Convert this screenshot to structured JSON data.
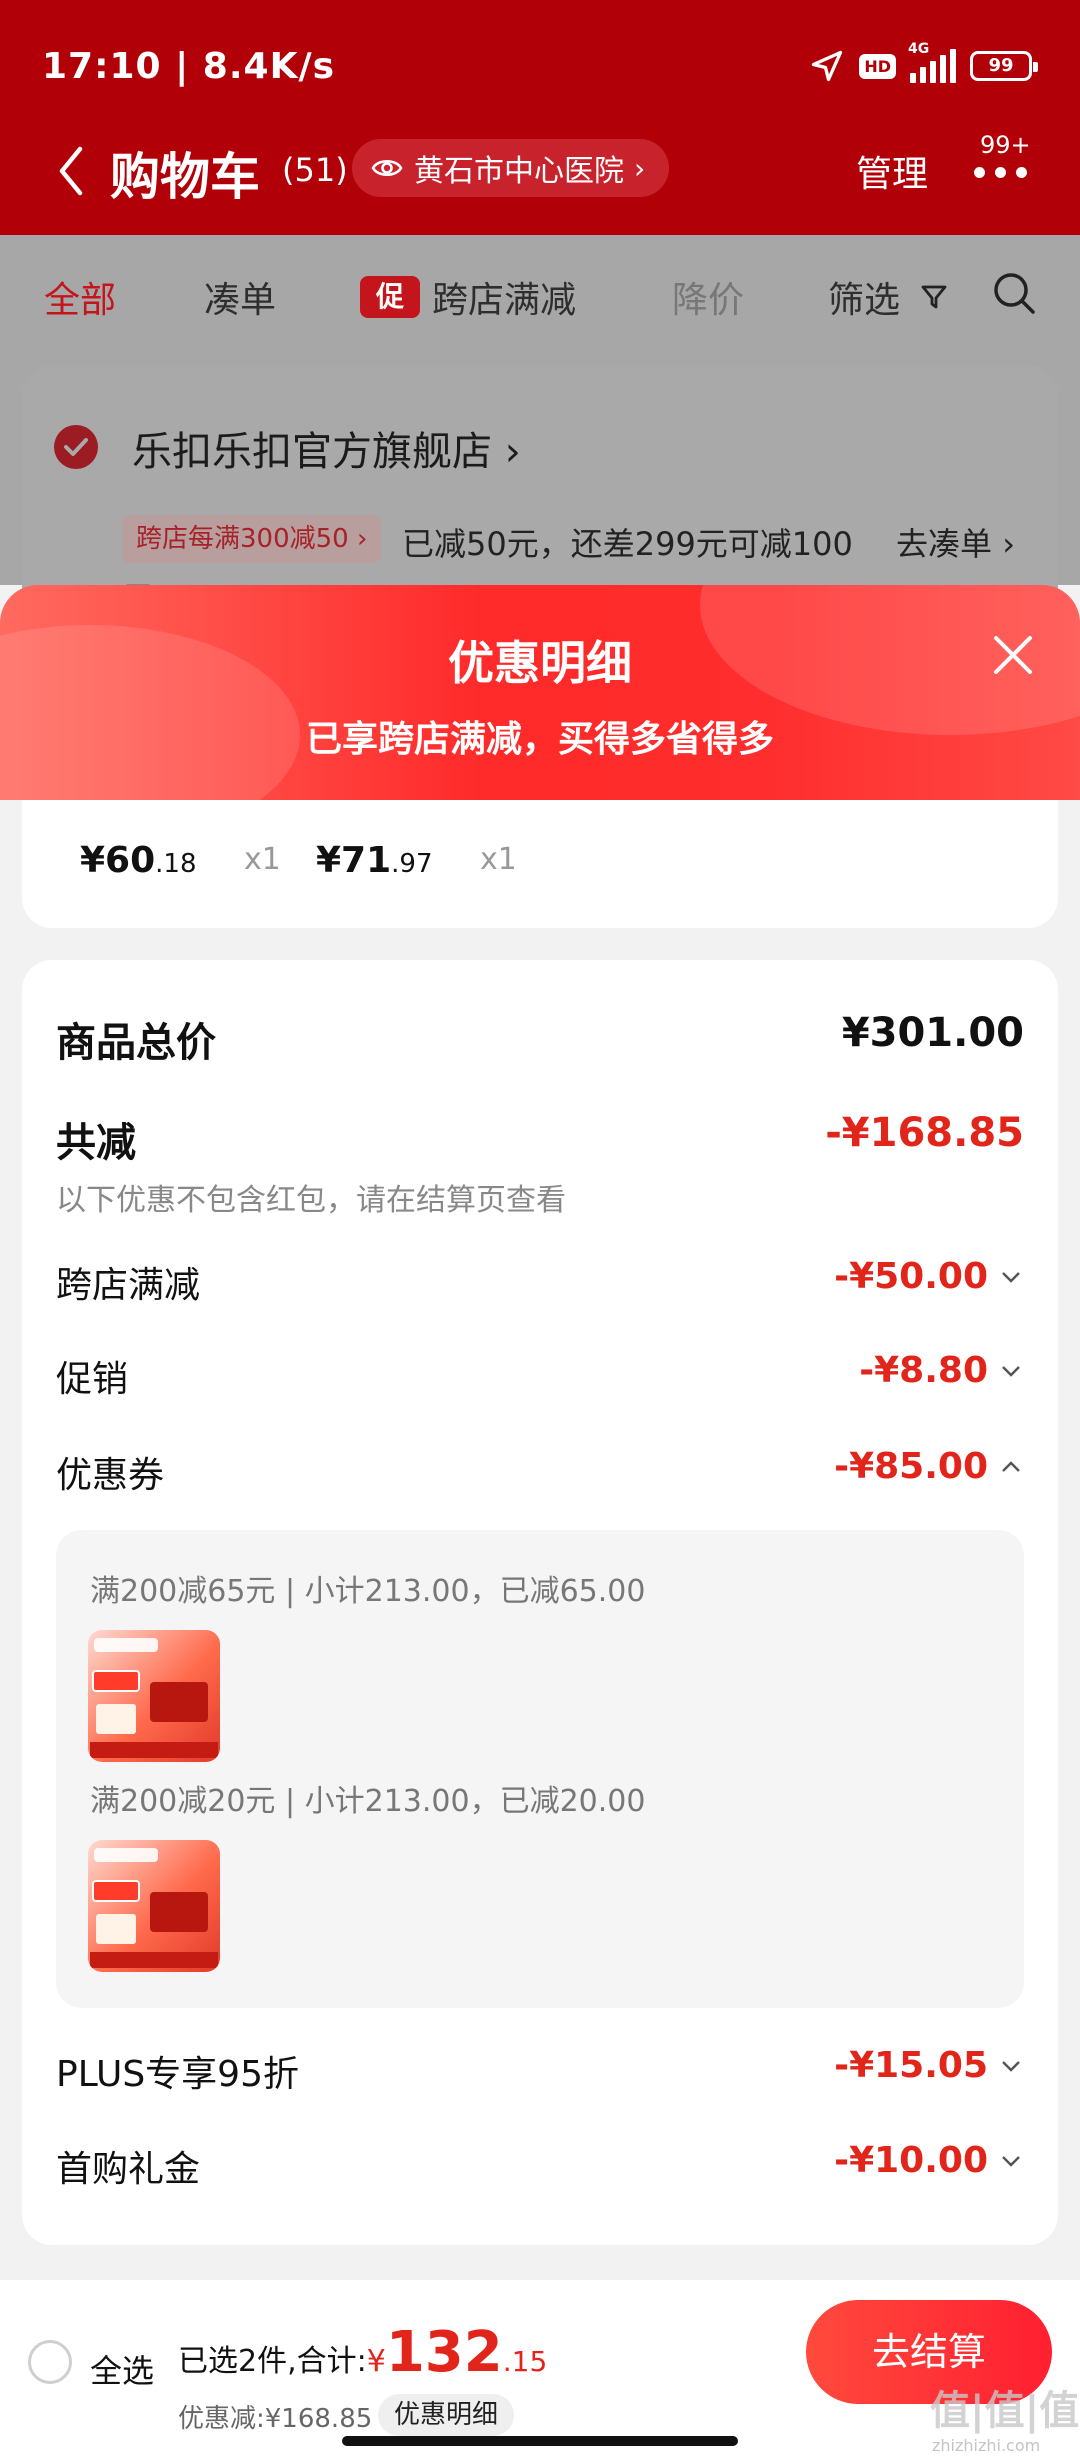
{
  "status_bar": {
    "time_speed": "17:10 | 8.4K/s",
    "hd": "HD",
    "network": "4G",
    "battery": "99"
  },
  "header": {
    "title": "购物车",
    "count": "(51)",
    "location": "黄石市中心医院",
    "manage_label": "管理",
    "badge": "99+"
  },
  "filter_tabs": {
    "all": "全部",
    "cou": "凑单",
    "cu_tag": "促",
    "cross_store": "跨店满减",
    "price_drop": "降价",
    "filter": "筛选"
  },
  "store": {
    "name": "乐扣乐扣官方旗舰店",
    "promo_pill": "跨店每满300减50",
    "promo_text": "已减50元，还差299元可减100",
    "go_cou": "去凑单",
    "overflow_text": "元"
  },
  "sheet": {
    "title": "优惠明细",
    "subtitle": "已享跨店满减，买得多省得多",
    "items": [
      {
        "price_int": "¥60",
        "price_dec": ".18",
        "qty": "x1"
      },
      {
        "price_int": "¥71",
        "price_dec": ".97",
        "qty": "x1"
      }
    ],
    "total_label": "商品总价",
    "total_value": "¥301.00",
    "discount_label": "共减",
    "discount_value": "-¥168.85",
    "note": "以下优惠不包含红包，请在结算页查看",
    "rows": {
      "cross_store": {
        "label": "跨店满减",
        "value": "-¥50.00"
      },
      "promotion": {
        "label": "促销",
        "value": "-¥8.80"
      },
      "coupon": {
        "label": "优惠券",
        "value": "-¥85.00"
      },
      "plus": {
        "label": "PLUS专享95折",
        "value": "-¥15.05"
      },
      "first_gift": {
        "label": "首购礼金",
        "value": "-¥10.00"
      }
    },
    "coupons": [
      {
        "text": "满200减65元 | 小计213.00，已减65.00"
      },
      {
        "text": "满200减20元 | 小计213.00，已减20.00"
      }
    ]
  },
  "bottom_bar": {
    "select_all": "全选",
    "selected_prefix": "已选2件,合计:",
    "currency": "¥",
    "total_int": "132",
    "total_dec": ".15",
    "saved_text": "优惠减:¥168.85",
    "detail_button": "优惠明细",
    "checkout_button": "去结算"
  },
  "watermark": {
    "logo": "值|值|值",
    "site": "zhizhizhi.com"
  },
  "colors": {
    "brand_red": "#b20008",
    "accent_red": "#e1251b"
  }
}
